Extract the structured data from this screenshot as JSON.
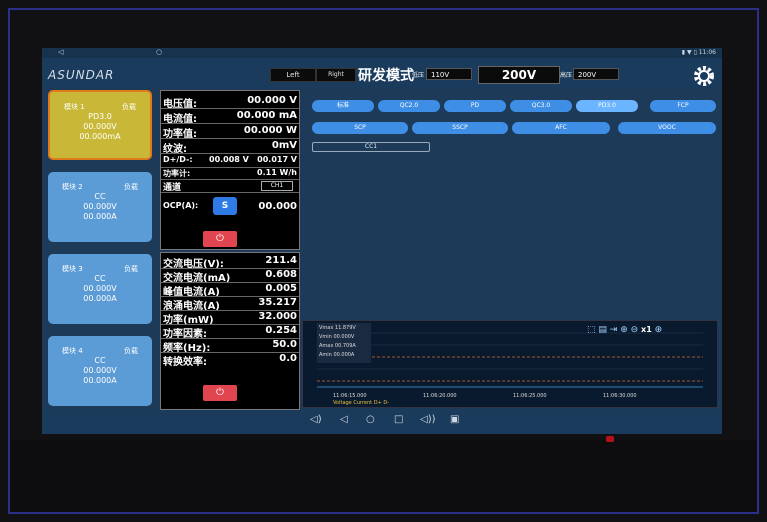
{
  "statusbar": {
    "back": "◁",
    "home": "○",
    "sys": "▮ ▼ ▯ 11:06"
  },
  "header": {
    "logo": "ASUNDAR",
    "left_btn": "Left",
    "right_btn": "Right",
    "mode": "研发模式",
    "low_v_label": "低压",
    "low_v": "110V",
    "main_v": "200V",
    "high_v_label": "高压",
    "high_v": "200V"
  },
  "modules": [
    {
      "name": "模块 1",
      "load": "负载",
      "type": "PD3.0",
      "v": "00.000V",
      "a": "00.000mA"
    },
    {
      "name": "模块 2",
      "load": "负载",
      "type": "CC",
      "v": "00.000V",
      "a": "00.000A"
    },
    {
      "name": "模块 3",
      "load": "负载",
      "type": "CC",
      "v": "00.000V",
      "a": "00.000A"
    },
    {
      "name": "模块 4",
      "load": "负载",
      "type": "CC",
      "v": "00.000V",
      "a": "00.000A"
    }
  ],
  "dc": {
    "voltage_l": "电压值:",
    "voltage_r": "00.000 V",
    "current_l": "电流值:",
    "current_r": "00.000 mA",
    "power_l": "功率值:",
    "power_r": "00.000 W",
    "ripple_l": "纹波:",
    "ripple_r": "0mV",
    "dd_l": "D+/D-:",
    "dd_m": "00.008 V",
    "dd_r": "00.017 V",
    "energy_l": "功率计:",
    "energy_r": "0.11 W/h",
    "channel_l": "通道",
    "channel_r": "CH1",
    "ocp_l": "OCP(A):",
    "ocp_btn": "S",
    "ocp_r": "00.000",
    "power_btn": "⏻"
  },
  "ac": {
    "rows": [
      {
        "l": "交流电压(V):",
        "r": "211.4"
      },
      {
        "l": "交流电流(mA)",
        "r": "0.608"
      },
      {
        "l": "峰值电流(A)",
        "r": "0.005"
      },
      {
        "l": "浪涌电流(A)",
        "r": "35.217"
      },
      {
        "l": "功率(mW)",
        "r": "32.000"
      },
      {
        "l": "功率因素:",
        "r": "0.254"
      },
      {
        "l": "频率(Hz):",
        "r": "50.0"
      },
      {
        "l": "转换效率:",
        "r": "0.0"
      }
    ],
    "power_btn": "⏻"
  },
  "protocols": {
    "row1": [
      "标准",
      "QC2.0",
      "PD",
      "QC3.0",
      "PD3.0",
      "FCP"
    ],
    "row2": [
      "SCP",
      "SSCP",
      "AFC",
      "VOOC"
    ],
    "selected": "PD3.0",
    "cc1": "CC1"
  },
  "chart": {
    "readouts": [
      "Vmax 11.879V",
      "Vmin 00.000V",
      "Amax 00.709A",
      "Amin 00.000A"
    ],
    "times": [
      "11:06:15.000",
      "11:06:20.000",
      "11:06:25.000",
      "11:06:30.000"
    ],
    "legend": "Voltage  Current  D+  D-",
    "zoom": "x1"
  },
  "nav": {
    "vol_down": "◁)",
    "back": "◁",
    "home": "○",
    "recent": "□",
    "vol_up": "◁))",
    "screenshot": "▣"
  },
  "colors": {
    "accent": "#3e8ee6",
    "active": "#c9b838",
    "power": "#e04550"
  }
}
